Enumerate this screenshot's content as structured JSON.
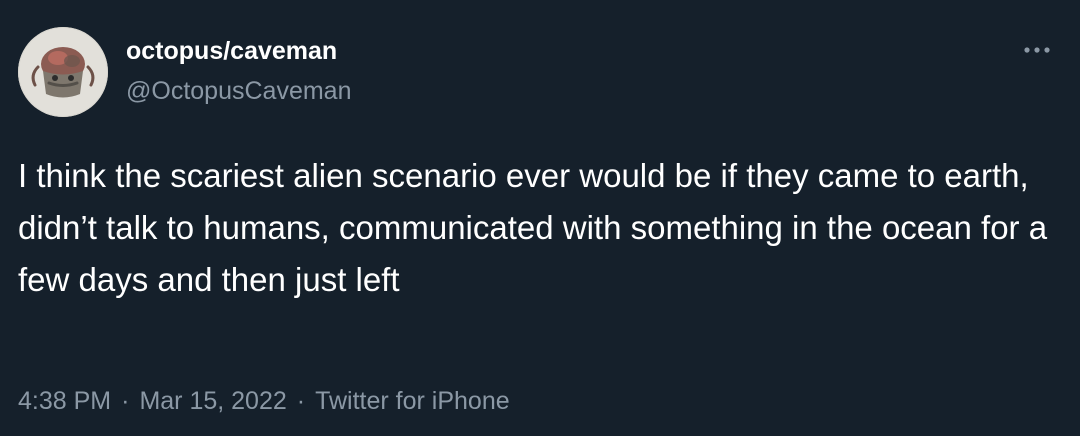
{
  "tweet": {
    "author": {
      "display_name": "octopus/caveman",
      "handle": "@OctopusCaveman"
    },
    "text": "I think the scariest alien scenario ever would be if they came to earth, didn’t talk to humans, communicated with something in the ocean for a few days and then just left",
    "time": "4:38 PM",
    "separator": "·",
    "date": "Mar 15, 2022",
    "source": "Twitter for iPhone"
  },
  "icons": {
    "more": "more-options-icon"
  },
  "colors": {
    "background": "#15202b",
    "primary_text": "#ffffff",
    "secondary_text": "#8b98a5"
  }
}
